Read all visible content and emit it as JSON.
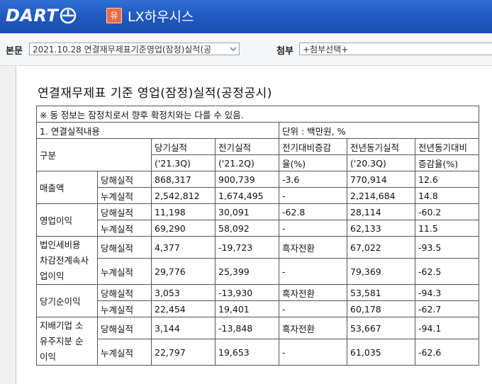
{
  "header": {
    "logo_text": "DART",
    "company_badge": "유",
    "company_name": "LX하우시스"
  },
  "toolbar": {
    "report_label": "본문",
    "report_selected": "2021.10.28  연결재무제표기준영업(잠정)실적(공",
    "attach_label": "첨부",
    "attach_selected": "+첨부선택+"
  },
  "document": {
    "title": "연결재무제표 기준 영업(잠정)실적(공정공시)",
    "notice": "※ 동 정보는 잠정치로서 향후 확정치와는 다를 수 있음.",
    "section": "1. 연결실적내용",
    "unit": "단위 : 백만원, %",
    "headers": {
      "category": "구분",
      "current": "당기실적",
      "current_period": "('21.3Q)",
      "previous": "전기실적",
      "previous_period": "('21.2Q)",
      "qoq": "전기대비증감",
      "qoq_unit": "율(%)",
      "yoy_base": "전년동기실적",
      "yoy_period": "('20.3Q)",
      "yoy": "전년동기대비",
      "yoy_unit": "증감율(%)"
    },
    "rows": [
      {
        "item": "매출액",
        "lines": [
          {
            "type": "당해실적",
            "current": "868,317",
            "previous": "900,739",
            "qoq": "-3.6",
            "last_year": "770,914",
            "yoy": "12.6"
          },
          {
            "type": "누계실적",
            "current": "2,542,812",
            "previous": "1,674,495",
            "qoq": "-",
            "last_year": "2,214,684",
            "yoy": "14.8"
          }
        ]
      },
      {
        "item": "영업이익",
        "lines": [
          {
            "type": "당해실적",
            "current": "11,198",
            "previous": "30,091",
            "qoq": "-62.8",
            "last_year": "28,114",
            "yoy": "-60.2"
          },
          {
            "type": "누계실적",
            "current": "69,290",
            "previous": "58,092",
            "qoq": "-",
            "last_year": "62,133",
            "yoy": "11.5"
          }
        ]
      },
      {
        "item_lines": [
          "법인세비용",
          "차감전계속사",
          "업이익"
        ],
        "lines": [
          {
            "type": "당해실적",
            "current": "4,377",
            "previous": "-19,723",
            "qoq": "흑자전환",
            "last_year": "67,022",
            "yoy": "-93.5"
          },
          {
            "type": "누계실적",
            "current": "29,776",
            "previous": "25,399",
            "qoq": "-",
            "last_year": "79,369",
            "yoy": "-62.5"
          }
        ]
      },
      {
        "item": "당기순이익",
        "lines": [
          {
            "type": "당해실적",
            "current": "3,053",
            "previous": "-13,930",
            "qoq": "흑자전환",
            "last_year": "53,581",
            "yoy": "-94.3"
          },
          {
            "type": "누계실적",
            "current": "22,454",
            "previous": "19,401",
            "qoq": "-",
            "last_year": "60,178",
            "yoy": "-62.7"
          }
        ]
      },
      {
        "item_lines": [
          "지배기업 소",
          "유주지분 순",
          "이익"
        ],
        "lines": [
          {
            "type": "당해실적",
            "current": "3,144",
            "previous": "-13,848",
            "qoq": "흑자전환",
            "last_year": "53,667",
            "yoy": "-94.1"
          },
          {
            "type": "누계실적",
            "current": "22,797",
            "previous": "19,653",
            "qoq": "-",
            "last_year": "61,035",
            "yoy": "-62.6"
          }
        ]
      }
    ]
  },
  "colors": {
    "header_blue": "#1f58bf",
    "badge_orange": "#f06a4a"
  }
}
